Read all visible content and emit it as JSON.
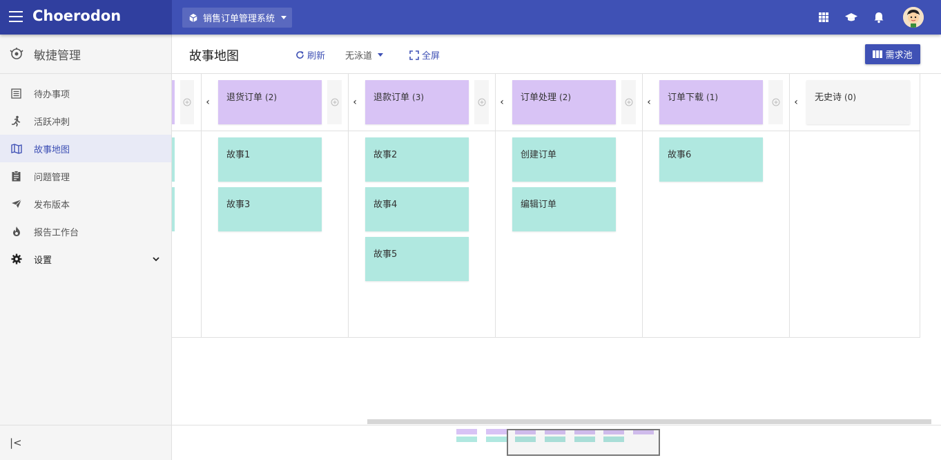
{
  "app": {
    "brand": "Choerodon",
    "project": "销售订单管理系统"
  },
  "sidebar": {
    "title": "敏捷管理",
    "items": [
      {
        "label": "待办事项"
      },
      {
        "label": "活跃冲刺"
      },
      {
        "label": "故事地图"
      },
      {
        "label": "问题管理"
      },
      {
        "label": "发布版本"
      },
      {
        "label": "报告工作台"
      },
      {
        "label": "设置"
      }
    ],
    "collapse": "|<"
  },
  "page": {
    "title": "故事地图",
    "refresh": "刷新",
    "swimlane": "无泳道",
    "fullscreen": "全屏",
    "backlog": "需求池"
  },
  "board": {
    "epics": [
      {
        "name": "退货订单",
        "count": "(2)",
        "stories": [
          "故事1",
          "故事3"
        ]
      },
      {
        "name": "退款订单",
        "count": "(3)",
        "stories": [
          "故事2",
          "故事4",
          "故事5"
        ]
      },
      {
        "name": "订单处理",
        "count": "(2)",
        "stories": [
          "创建订单",
          "编辑订单"
        ]
      },
      {
        "name": "订单下载",
        "count": "(1)",
        "stories": [
          "故事6"
        ]
      },
      {
        "name": "无史诗",
        "count": "(0)",
        "stories": []
      }
    ]
  },
  "colors": {
    "primary": "#3f51b5",
    "primary_dark": "#303f9f",
    "epic": "#d8c3f5",
    "story": "#b0e8e0"
  }
}
